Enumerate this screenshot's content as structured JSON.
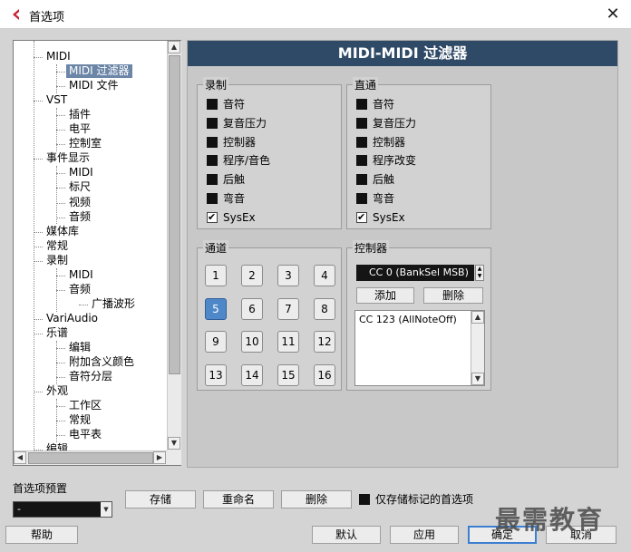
{
  "window": {
    "title": "首选项",
    "close_glyph": "✕"
  },
  "tree": {
    "items": [
      {
        "label": "MIDI",
        "level": 1
      },
      {
        "label": "MIDI 过滤器",
        "level": 2,
        "selected": true
      },
      {
        "label": "MIDI 文件",
        "level": 2
      },
      {
        "label": "VST",
        "level": 1
      },
      {
        "label": "插件",
        "level": 2
      },
      {
        "label": "电平",
        "level": 2
      },
      {
        "label": "控制室",
        "level": 2
      },
      {
        "label": "事件显示",
        "level": 1
      },
      {
        "label": "MIDI",
        "level": 2
      },
      {
        "label": "标尺",
        "level": 2
      },
      {
        "label": "视频",
        "level": 2
      },
      {
        "label": "音频",
        "level": 2
      },
      {
        "label": "媒体库",
        "level": 1
      },
      {
        "label": "常规",
        "level": 1
      },
      {
        "label": "录制",
        "level": 1
      },
      {
        "label": "MIDI",
        "level": 2
      },
      {
        "label": "音频",
        "level": 2
      },
      {
        "label": "广播波形",
        "level": 3
      },
      {
        "label": "VariAudio",
        "level": 1
      },
      {
        "label": "乐谱",
        "level": 1
      },
      {
        "label": "编辑",
        "level": 2
      },
      {
        "label": "附加含义颜色",
        "level": 2
      },
      {
        "label": "音符分层",
        "level": 2
      },
      {
        "label": "外观",
        "level": 1
      },
      {
        "label": "工作区",
        "level": 2
      },
      {
        "label": "常规",
        "level": 2
      },
      {
        "label": "电平表",
        "level": 2
      },
      {
        "label": "编辑",
        "level": 1
      }
    ],
    "scroll_up": "▲",
    "scroll_down": "▼",
    "scroll_left": "◀",
    "scroll_right": "▶"
  },
  "panel": {
    "title": "MIDI-MIDI 过滤器",
    "record": {
      "label": "录制",
      "items": [
        {
          "label": "音符",
          "checked": false
        },
        {
          "label": "复音压力",
          "checked": false
        },
        {
          "label": "控制器",
          "checked": false
        },
        {
          "label": "程序/音色",
          "checked": false
        },
        {
          "label": "后触",
          "checked": false
        },
        {
          "label": "弯音",
          "checked": false
        },
        {
          "label": "SysEx",
          "checked": true
        }
      ]
    },
    "thru": {
      "label": "直通",
      "items": [
        {
          "label": "音符",
          "checked": false
        },
        {
          "label": "复音压力",
          "checked": false
        },
        {
          "label": "控制器",
          "checked": false
        },
        {
          "label": "程序改变",
          "checked": false
        },
        {
          "label": "后触",
          "checked": false
        },
        {
          "label": "弯音",
          "checked": false
        },
        {
          "label": "SysEx",
          "checked": true
        }
      ]
    },
    "channels": {
      "label": "通道",
      "buttons": [
        "1",
        "2",
        "3",
        "4",
        "5",
        "6",
        "7",
        "8",
        "9",
        "10",
        "11",
        "12",
        "13",
        "14",
        "15",
        "16"
      ],
      "active": "5"
    },
    "controllers": {
      "label": "控制器",
      "selected": "CC 0  (BankSel MSB)",
      "add_label": "添加",
      "delete_label": "删除",
      "list": [
        "CC 123  (AllNoteOff)"
      ]
    }
  },
  "bottom": {
    "presets_label": "首选项预置",
    "preset_value": "-",
    "store_label": "存储",
    "rename_label": "重命名",
    "delete_label": "删除",
    "store_marked_label": "仅存储标记的首选项",
    "help_label": "帮助",
    "default_label": "默认",
    "apply_label": "应用",
    "ok_label": "确定",
    "cancel_label": "取消",
    "watermark": "最需教育"
  },
  "colors": {
    "header": "#2f4a66",
    "selection": "#6c86a8",
    "active_channel": "#4f88c8"
  }
}
